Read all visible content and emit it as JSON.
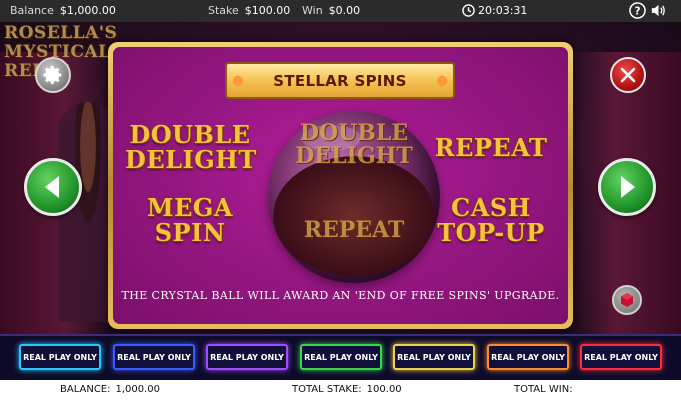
{
  "topbar": {
    "balance_label": "Balance",
    "balance_value": "$1,000.00",
    "stake_label": "Stake",
    "stake_value": "$100.00",
    "win_label": "Win",
    "win_value": "$0.00",
    "clock": "20:03:31",
    "icons": [
      "clock-icon",
      "help-icon",
      "sound-icon"
    ]
  },
  "scene": {
    "logo_text": "ROSELLA'S MYSTICAL REELS"
  },
  "panel": {
    "title": "STELLAR SPINS",
    "features": {
      "top_left": "DOUBLE DELIGHT",
      "top_right": "REPEAT",
      "bottom_left": "MEGA SPIN",
      "bottom_right": "CASH TOP-UP"
    },
    "ball": {
      "top": "DOUBLE DELIGHT",
      "bottom": "REPEAT"
    },
    "description": "THE CRYSTAL BALL WILL AWARD AN 'END OF FREE SPINS' UPGRADE."
  },
  "buttons": {
    "icons": [
      "gear-icon",
      "close-icon",
      "arrow-left-icon",
      "arrow-right-icon",
      "dice-icon"
    ]
  },
  "real_play": {
    "label": "REAL PLAY ONLY",
    "colors": [
      "#27c7ff",
      "#3a5bff",
      "#a04cff",
      "#38d64a",
      "#f0d24a",
      "#ff8a2a",
      "#ff2a3a"
    ]
  },
  "bottombar": {
    "balance_label": "BALANCE:",
    "balance_value": "1,000.00",
    "stake_label": "TOTAL STAKE:",
    "stake_value": "100.00",
    "win_label": "TOTAL WIN:",
    "win_value": ""
  }
}
